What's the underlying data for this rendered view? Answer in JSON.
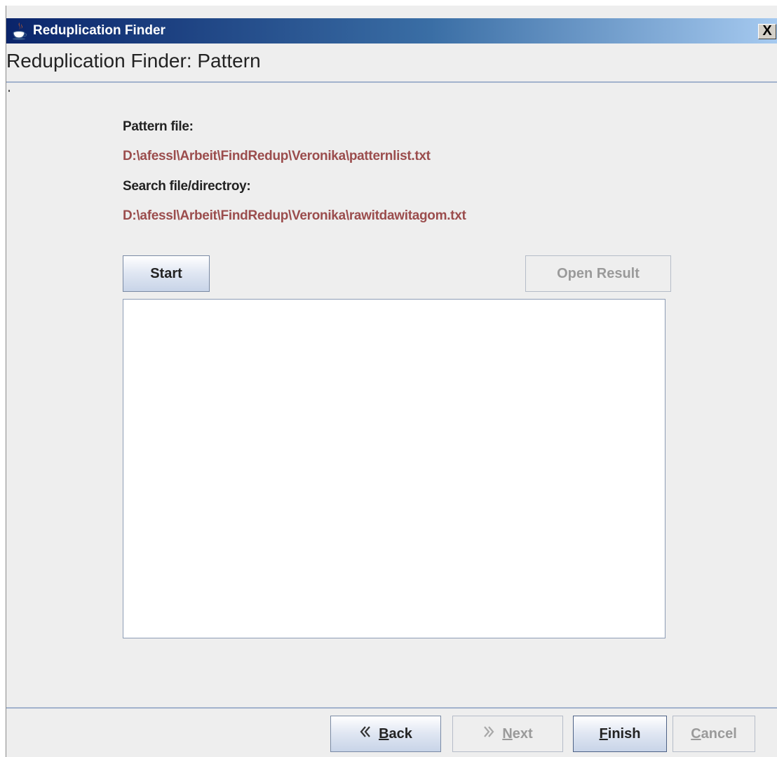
{
  "window": {
    "title": "Reduplication Finder",
    "close_symbol": "X"
  },
  "header": {
    "page_title": "Reduplication Finder: Pattern"
  },
  "form": {
    "pattern_file_label": "Pattern file:",
    "pattern_file_path": "D:\\afessl\\Arbeit\\FindRedup\\Veronika\\patternlist.txt",
    "search_file_label": "Search file/directroy:",
    "search_file_path": "D:\\afessl\\Arbeit\\FindRedup\\Veronika\\rawitdawitagom.txt"
  },
  "actions": {
    "start_label": "Start",
    "open_result_label": "Open Result"
  },
  "footer": {
    "back_label": "Back",
    "next_label": "Next",
    "finish_label": "Finish",
    "cancel_label": "Cancel"
  },
  "icons": {
    "app": "java-cup-icon",
    "back": "double-chevron-left-icon",
    "next": "double-chevron-right-icon"
  },
  "colors": {
    "path_text": "#9b4d4d",
    "titlebar_start": "#0a246a",
    "titlebar_end": "#a6caf0"
  }
}
